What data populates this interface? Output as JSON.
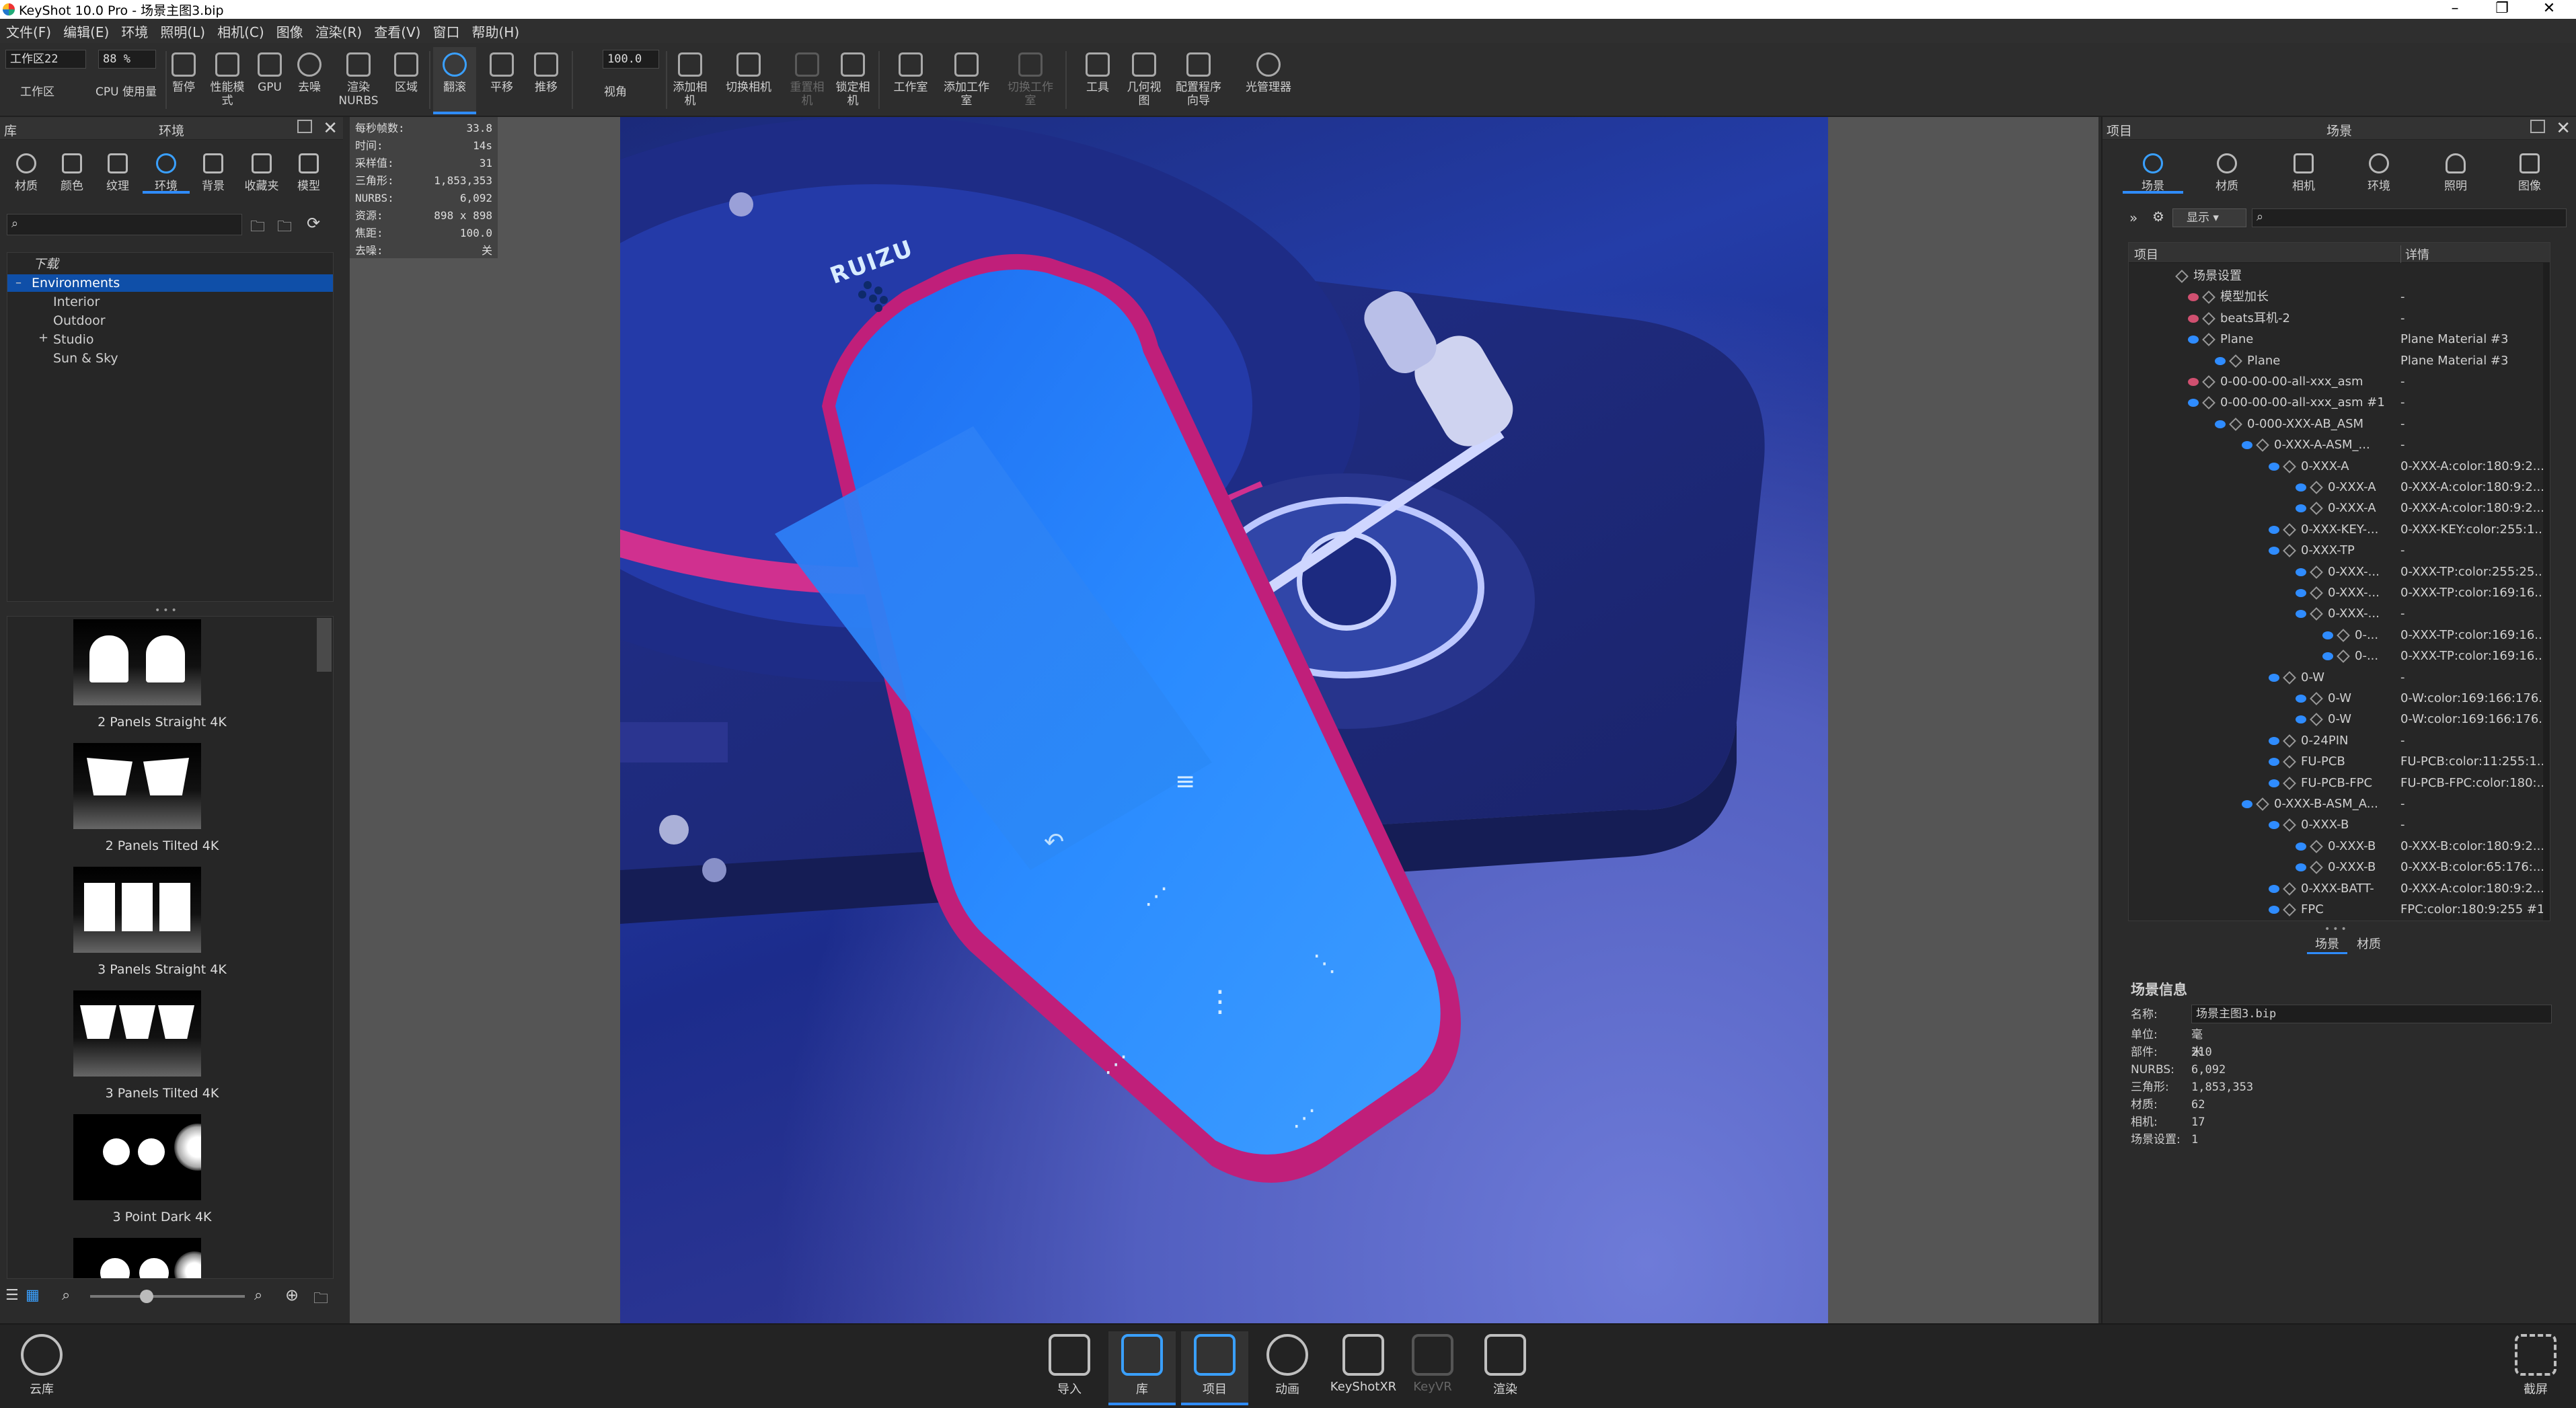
{
  "window": {
    "title": "KeyShot 10.0 Pro  - 场景主图3.bip"
  },
  "menu": [
    "文件(F)",
    "编辑(E)",
    "环境",
    "照明(L)",
    "相机(C)",
    "图像",
    "渲染(R)",
    "查看(V)",
    "窗口",
    "帮助(H)"
  ],
  "toolbar": {
    "workspace_value": "工作区22",
    "cpu_value": "88 %",
    "workspace_label": "工作区",
    "cpu_label": "CPU 使用量",
    "pause": "暂停",
    "perf_mode": "性能模式",
    "gpu": "GPU",
    "denoise": "去噪",
    "render_nurbs": "渲染NURBS",
    "region": "区域",
    "tumble": "翻滚",
    "pan": "平移",
    "dolly": "推移",
    "fov_value": "100.0",
    "fov": "视角",
    "add_camera": "添加相机",
    "switch_camera": "切换相机",
    "reset_camera": "重置相机",
    "lock_camera": "锁定相机",
    "studio": "工作室",
    "add_studio": "添加工作室",
    "switch_studio": "切换工作室",
    "tools": "工具",
    "geometry_view": "几何视图",
    "configurator": "配置程序向导",
    "light_manager": "光管理器"
  },
  "library": {
    "panel_left": "库",
    "panel_title": "环境",
    "tabs": [
      "材质",
      "颜色",
      "纹理",
      "环境",
      "背景",
      "收藏夹",
      "模型"
    ],
    "active_tab": "环境",
    "tree": [
      {
        "label": "下载",
        "italic": true
      },
      {
        "label": "Environments",
        "selected": true
      },
      {
        "label": "Interior"
      },
      {
        "label": "Outdoor"
      },
      {
        "label": "Studio"
      },
      {
        "label": "Sun & Sky"
      }
    ],
    "thumbnails": [
      "2 Panels Straight 4K",
      "2 Panels Tilted 4K",
      "3 Panels Straight 4K",
      "3 Panels Tilted 4K",
      "3 Point Dark 4K"
    ]
  },
  "stats": [
    {
      "k": "每秒帧数:",
      "v": "33.8"
    },
    {
      "k": "时间:",
      "v": "14s"
    },
    {
      "k": "采样值:",
      "v": "31"
    },
    {
      "k": "三角形:",
      "v": "1,853,353"
    },
    {
      "k": "NURBS:",
      "v": "6,092"
    },
    {
      "k": "资源:",
      "v": "898 x 898"
    },
    {
      "k": "焦距:",
      "v": "100.0"
    },
    {
      "k": "去噪:",
      "v": "关"
    }
  ],
  "render": {
    "brand": "RUIZU"
  },
  "scene": {
    "panel_left": "项目",
    "panel_title": "场景",
    "tabs": [
      "场景",
      "材质",
      "相机",
      "环境",
      "照明",
      "图像"
    ],
    "active_tab": "场景",
    "toolbar_show": "显示",
    "col_item": "项目",
    "col_detail": "详情",
    "rows": [
      {
        "d": 0,
        "n": "场景设置",
        "det": "",
        "eye": "none"
      },
      {
        "d": 1,
        "n": "模型加长",
        "det": "-",
        "eye": "off"
      },
      {
        "d": 1,
        "n": "beats耳机-2",
        "det": "-",
        "eye": "off"
      },
      {
        "d": 1,
        "n": "Plane",
        "det": "Plane Material #3",
        "eye": "on"
      },
      {
        "d": 2,
        "n": "Plane",
        "det": "Plane Material #3",
        "eye": "on"
      },
      {
        "d": 1,
        "n": "0-00-00-00-all-xxx_asm",
        "det": "-",
        "eye": "off"
      },
      {
        "d": 1,
        "n": "0-00-00-00-all-xxx_asm #1",
        "det": "-",
        "eye": "on"
      },
      {
        "d": 2,
        "n": "0-000-XXX-AB_ASM",
        "det": "-",
        "eye": "on"
      },
      {
        "d": 3,
        "n": "0-XXX-A-ASM_...",
        "det": "-",
        "eye": "on"
      },
      {
        "d": 4,
        "n": "0-XXX-A",
        "det": "0-XXX-A:color:180:9:2...",
        "eye": "on"
      },
      {
        "d": 5,
        "n": "0-XXX-A",
        "det": "0-XXX-A:color:180:9:2...",
        "eye": "on"
      },
      {
        "d": 5,
        "n": "0-XXX-A",
        "det": "0-XXX-A:color:180:9:2...",
        "eye": "on"
      },
      {
        "d": 4,
        "n": "0-XXX-KEY-...",
        "det": "0-XXX-KEY:color:255:1...",
        "eye": "on"
      },
      {
        "d": 4,
        "n": "0-XXX-TP",
        "det": "-",
        "eye": "on"
      },
      {
        "d": 5,
        "n": "0-XXX-...",
        "det": "0-XXX-TP:color:255:25...",
        "eye": "on"
      },
      {
        "d": 5,
        "n": "0-XXX-...",
        "det": "0-XXX-TP:color:169:16...",
        "eye": "on"
      },
      {
        "d": 5,
        "n": "0-XXX-...",
        "det": "-",
        "eye": "on"
      },
      {
        "d": 6,
        "n": "0-...",
        "det": "0-XXX-TP:color:169:16...",
        "eye": "on"
      },
      {
        "d": 6,
        "n": "0-...",
        "det": "0-XXX-TP:color:169:16...",
        "eye": "on"
      },
      {
        "d": 4,
        "n": "0-W",
        "det": "-",
        "eye": "on"
      },
      {
        "d": 5,
        "n": "0-W",
        "det": "0-W:color:169:166:176...",
        "eye": "on"
      },
      {
        "d": 5,
        "n": "0-W",
        "det": "0-W:color:169:166:176...",
        "eye": "on"
      },
      {
        "d": 4,
        "n": "0-24PIN",
        "det": "-",
        "eye": "on"
      },
      {
        "d": 4,
        "n": "FU-PCB",
        "det": "FU-PCB:color:11:255:1...",
        "eye": "on"
      },
      {
        "d": 4,
        "n": "FU-PCB-FPC",
        "det": "FU-PCB-FPC:color:180:...",
        "eye": "on"
      },
      {
        "d": 3,
        "n": "0-XXX-B-ASM_A...",
        "det": "-",
        "eye": "on"
      },
      {
        "d": 4,
        "n": "0-XXX-B",
        "det": "-",
        "eye": "on"
      },
      {
        "d": 5,
        "n": "0-XXX-B",
        "det": "0-XXX-B:color:180:9:2...",
        "eye": "on"
      },
      {
        "d": 5,
        "n": "0-XXX-B",
        "det": "0-XXX-B:color:65:176:...",
        "eye": "on"
      },
      {
        "d": 4,
        "n": "0-XXX-BATT-",
        "det": "0-XXX-A:color:180:9:2...",
        "eye": "on"
      },
      {
        "d": 4,
        "n": "FPC",
        "det": "FPC:color:180:9:255 #1",
        "eye": "on"
      }
    ],
    "bottom_tabs": [
      "场景",
      "材质"
    ]
  },
  "scene_info": {
    "title": "场景信息",
    "rows": [
      {
        "k": "名称:",
        "v": "场景主图3.bip"
      },
      {
        "k": "单位:",
        "v": "毫米"
      },
      {
        "k": "部件:",
        "v": "210"
      },
      {
        "k": "NURBS:",
        "v": "6,092"
      },
      {
        "k": "三角形:",
        "v": "1,853,353"
      },
      {
        "k": "材质:",
        "v": "62"
      },
      {
        "k": "相机:",
        "v": "17"
      },
      {
        "k": "场景设置:",
        "v": "1"
      }
    ]
  },
  "bottombar": {
    "cloud": "云库",
    "items": [
      "导入",
      "库",
      "项目",
      "动画",
      "KeyShotXR",
      "KeyVR",
      "渲染"
    ],
    "screenshot": "截屏"
  }
}
